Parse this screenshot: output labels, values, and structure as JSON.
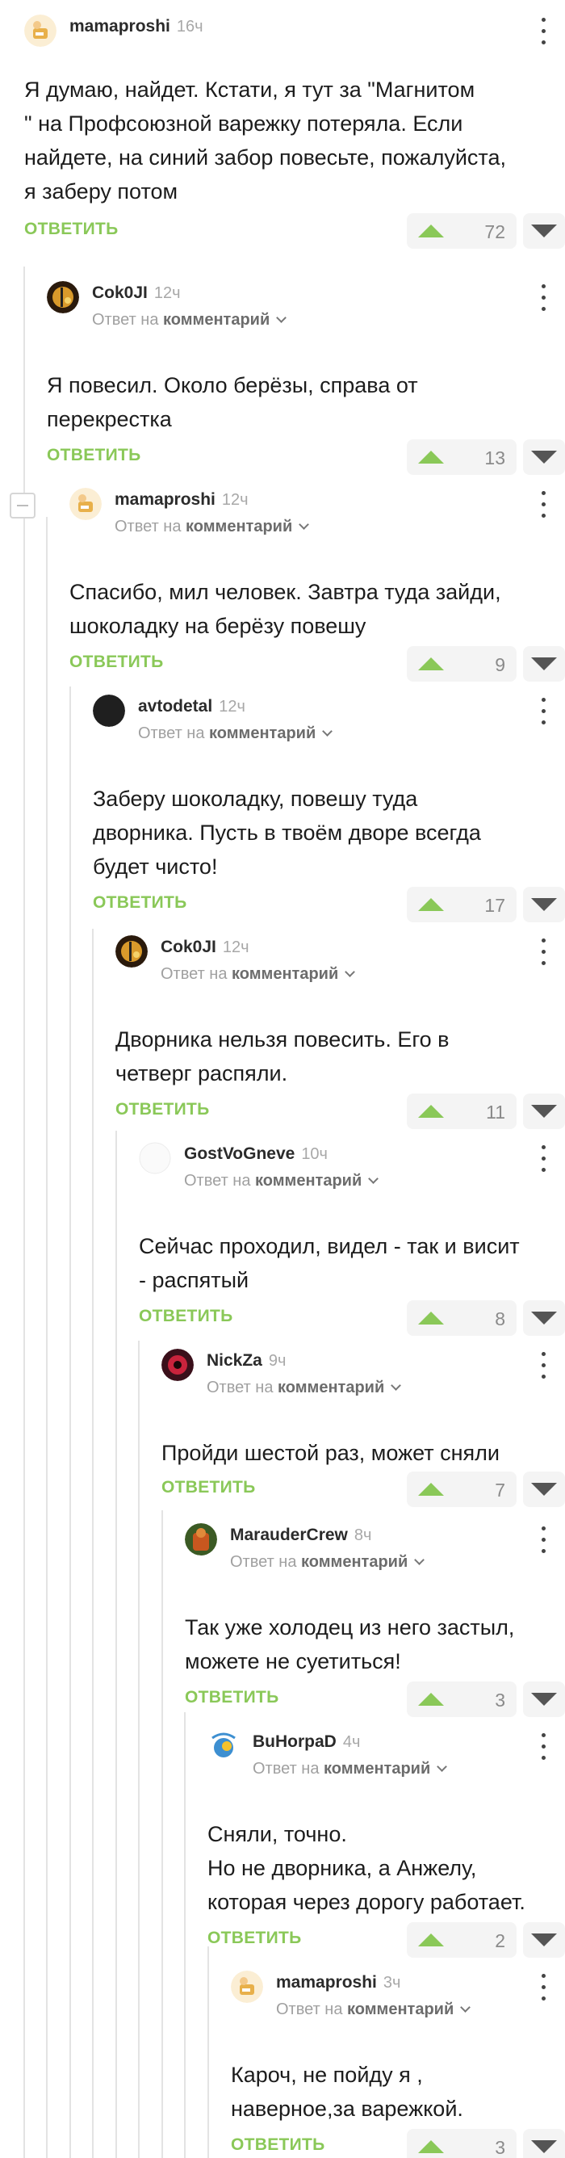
{
  "comments": [
    {
      "author": "mamaproshi",
      "time": "16ч",
      "reply_prefix": "",
      "reply_target": "",
      "text": "Я думаю, найдет. Кстати, я тут за \"Магнитом\n\" на Профсоюзной варежку потеряла. Если\nнайдете, на синий забор повесьте, пожалуйста,\nя заберу потом",
      "reply_label": "ОТВЕТИТЬ",
      "score": "72"
    },
    {
      "author": "Cok0JI",
      "time": "12ч",
      "reply_prefix": "Ответ на",
      "reply_target": "комментарий",
      "text": "Я повесил. Около берёзы, справа от\nперекрестка",
      "reply_label": "ОТВЕТИТЬ",
      "score": "13"
    },
    {
      "author": "mamaproshi",
      "time": "12ч",
      "reply_prefix": "Ответ на",
      "reply_target": "комментарий",
      "text": "Спасибо, мил человек. Завтра туда зайди,\nшоколадку на берёзу повешу",
      "reply_label": "ОТВЕТИТЬ",
      "score": "9"
    },
    {
      "author": "avtodetal",
      "time": "12ч",
      "reply_prefix": "Ответ на",
      "reply_target": "комментарий",
      "text": "Заберу шоколадку, повешу туда\nдворника. Пусть в твоём дворе всегда\nбудет чисто!",
      "reply_label": "ОТВЕТИТЬ",
      "score": "17"
    },
    {
      "author": "Cok0JI",
      "time": "12ч",
      "reply_prefix": "Ответ на",
      "reply_target": "комментарий",
      "text": "Дворника нельзя повесить. Его в\nчетверг распяли.",
      "reply_label": "ОТВЕТИТЬ",
      "score": "11"
    },
    {
      "author": "GostVoGneve",
      "time": "10ч",
      "reply_prefix": "Ответ на",
      "reply_target": "комментарий",
      "text": "Сейчас проходил, видел - так и висит\n- распятый",
      "reply_label": "ОТВЕТИТЬ",
      "score": "8"
    },
    {
      "author": "NickZa",
      "time": "9ч",
      "reply_prefix": "Ответ на",
      "reply_target": "комментарий",
      "text": "Пройди шестой раз, может сняли",
      "reply_label": "ОТВЕТИТЬ",
      "score": "7"
    },
    {
      "author": "MarauderCrew",
      "time": "8ч",
      "reply_prefix": "Ответ на",
      "reply_target": "комментарий",
      "text": "Так уже холодец из него застыл,\nможете не суетиться!",
      "reply_label": "ОТВЕТИТЬ",
      "score": "3"
    },
    {
      "author": "BuHorpaD",
      "time": "4ч",
      "reply_prefix": "Ответ на",
      "reply_target": "комментарий",
      "text": "Сняли, точно.\nНо не дворника, а Анжелу,\nкоторая через дорогу работает.",
      "reply_label": "ОТВЕТИТЬ",
      "score": "2"
    },
    {
      "author": "mamaproshi",
      "time": "3ч",
      "reply_prefix": "Ответ на",
      "reply_target": "комментарий",
      "text": "Кароч, не пойду я ,\nнаверное,за варежкой.",
      "reply_label": "ОТВЕТИТЬ",
      "score": "3"
    }
  ]
}
